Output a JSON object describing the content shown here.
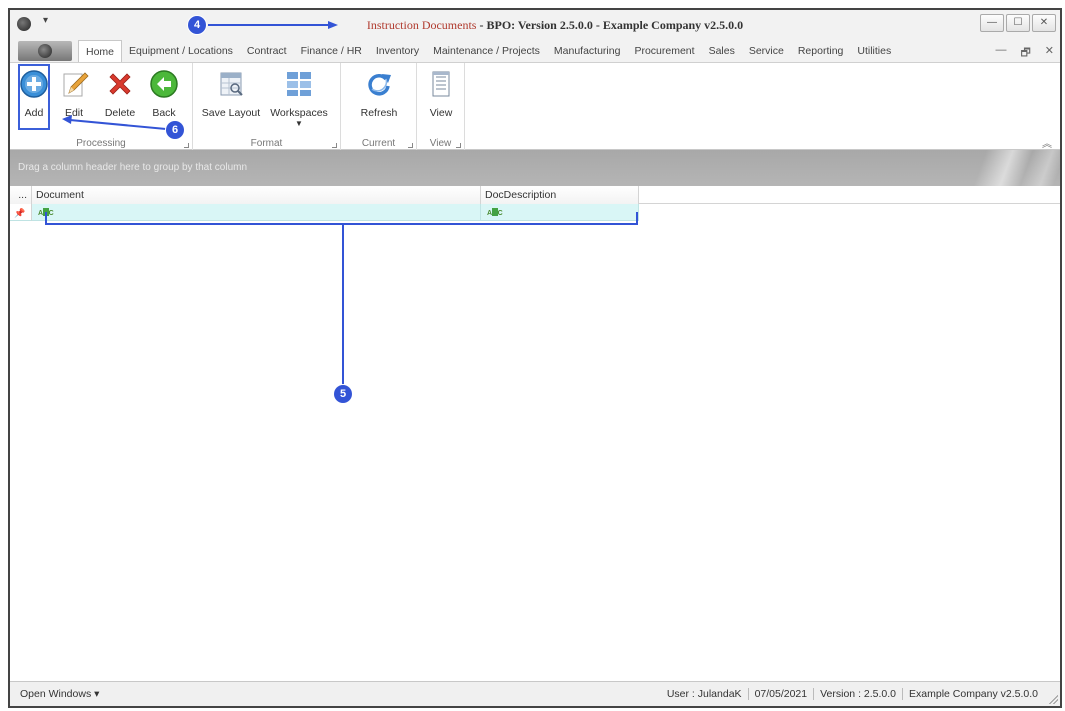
{
  "window": {
    "title_doc": "Instruction Documents",
    "title_rest": " - BPO: Version 2.5.0.0 - Example Company v2.5.0.0",
    "buttons": {
      "minimize": "—",
      "maximize": "☐",
      "close": "✕"
    },
    "qat_arrow": "▾",
    "mdi_buttons": {
      "minimize": "—",
      "restore": "🗗",
      "close": "✕"
    }
  },
  "tabs": [
    {
      "label": "Home",
      "active": true
    },
    {
      "label": "Equipment / Locations"
    },
    {
      "label": "Contract"
    },
    {
      "label": "Finance / HR"
    },
    {
      "label": "Inventory"
    },
    {
      "label": "Maintenance / Projects"
    },
    {
      "label": "Manufacturing"
    },
    {
      "label": "Procurement"
    },
    {
      "label": "Sales"
    },
    {
      "label": "Service"
    },
    {
      "label": "Reporting"
    },
    {
      "label": "Utilities"
    }
  ],
  "ribbon": {
    "processing": {
      "label": "Processing",
      "add": "Add",
      "edit": "Edit",
      "delete": "Delete",
      "back": "Back"
    },
    "format": {
      "label": "Format",
      "save_layout": "Save Layout",
      "workspaces": "Workspaces"
    },
    "current": {
      "label": "Current",
      "refresh": "Refresh"
    },
    "view": {
      "label": "View",
      "view": "View"
    },
    "collapse": "︽"
  },
  "grid": {
    "group_panel_text": "Drag a column header here to group by that column",
    "indicator_header": "...",
    "columns": [
      {
        "header": "Document"
      },
      {
        "header": "DocDescription"
      }
    ],
    "filter_abc": "ABC"
  },
  "statusbar": {
    "open_windows": "Open Windows ▾",
    "user": "User : JulandaK",
    "date": "07/05/2021",
    "version": "Version : 2.5.0.0",
    "company": "Example Company v2.5.0.0"
  },
  "annotations": {
    "callout_4": "4",
    "callout_5": "5",
    "callout_6": "6",
    "color": "#3354d6"
  }
}
